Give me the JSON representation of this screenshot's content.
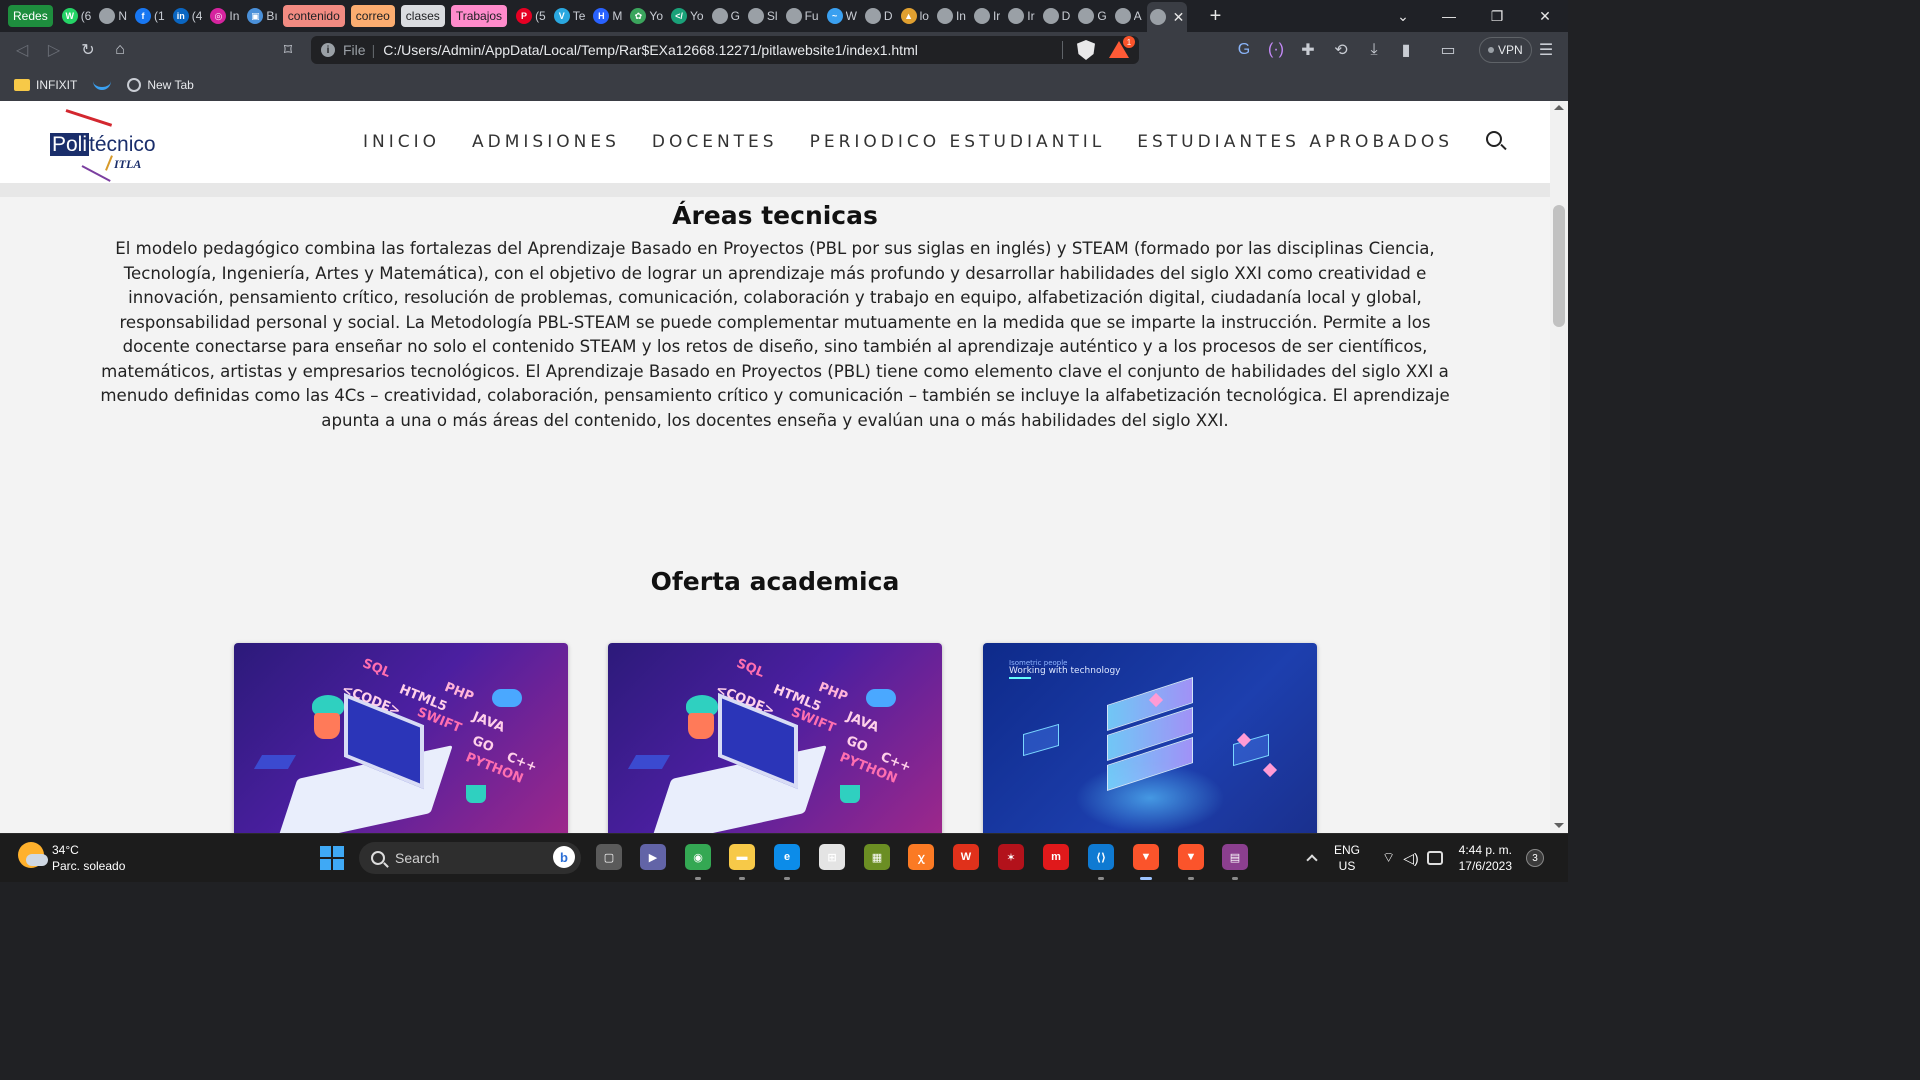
{
  "browser": {
    "tab_groups": [
      {
        "label": "Redes",
        "color": "#1e8e3e",
        "text_color": "#ffffff"
      },
      {
        "label": "contenido",
        "color": "#f28b82",
        "text_color": "#202124"
      },
      {
        "label": "correo",
        "color": "#fcad70",
        "text_color": "#202124"
      },
      {
        "label": "clases",
        "color": "#dadce0",
        "text_color": "#202124"
      },
      {
        "label": "Trabajos",
        "color": "#ff8bcb",
        "text_color": "#202124"
      }
    ],
    "tabs_redes": [
      {
        "icon": "whatsapp-icon",
        "glyph": "W",
        "color": "#25d366",
        "label": "(6"
      },
      {
        "icon": "globe-icon",
        "glyph": "",
        "color": "#9aa0a6",
        "label": "N"
      },
      {
        "icon": "facebook-icon",
        "glyph": "f",
        "color": "#1877f2",
        "label": "(1"
      },
      {
        "icon": "linkedin-icon",
        "glyph": "in",
        "color": "#0a66c2",
        "label": "(4"
      },
      {
        "icon": "instagram-icon",
        "glyph": "◎",
        "color": "#d6249f",
        "label": "In"
      },
      {
        "icon": "image-icon",
        "glyph": "▣",
        "color": "#4a90d9",
        "label": "Bı"
      }
    ],
    "tabs_trabajos": [
      {
        "icon": "pinterest-icon",
        "glyph": "P",
        "color": "#e60023",
        "label": "(5"
      },
      {
        "icon": "tw-icon",
        "glyph": "V",
        "color": "#2aa8e0",
        "label": "Te"
      },
      {
        "icon": "hashnode-icon",
        "glyph": "H",
        "color": "#2962ff",
        "label": "M"
      },
      {
        "icon": "leaf-icon",
        "glyph": "✿",
        "color": "#3ba55d",
        "label": "Yo"
      },
      {
        "icon": "code-icon",
        "glyph": "</",
        "color": "#1aa179",
        "label": "Yo"
      },
      {
        "icon": "globe-icon",
        "glyph": "",
        "color": "#9aa0a6",
        "label": "G"
      },
      {
        "icon": "globe-icon",
        "glyph": "",
        "color": "#9aa0a6",
        "label": "Sl"
      },
      {
        "icon": "globe-icon",
        "glyph": "",
        "color": "#9aa0a6",
        "label": "Fu"
      },
      {
        "icon": "wave-icon",
        "glyph": "~",
        "color": "#3aa0f0",
        "label": "W"
      },
      {
        "icon": "globe-icon",
        "glyph": "",
        "color": "#9aa0a6",
        "label": "D"
      },
      {
        "icon": "itla-icon",
        "glyph": "▲",
        "color": "#e0a030",
        "label": "lo"
      },
      {
        "icon": "globe-icon",
        "glyph": "",
        "color": "#9aa0a6",
        "label": "In"
      },
      {
        "icon": "globe-icon",
        "glyph": "",
        "color": "#9aa0a6",
        "label": "Ir"
      },
      {
        "icon": "globe-icon",
        "glyph": "",
        "color": "#9aa0a6",
        "label": "Ir"
      },
      {
        "icon": "globe-icon",
        "glyph": "",
        "color": "#9aa0a6",
        "label": "D"
      },
      {
        "icon": "globe-icon",
        "glyph": "",
        "color": "#9aa0a6",
        "label": "G"
      },
      {
        "icon": "globe-icon",
        "glyph": "",
        "color": "#9aa0a6",
        "label": "A"
      }
    ],
    "active_tab": {
      "label": "",
      "close": "✕"
    },
    "new_tab": "+",
    "window": {
      "dropdown": "⌄",
      "minimize": "—",
      "restore": "❐",
      "close": "✕"
    },
    "address": {
      "scheme_label": "File",
      "separator": "|",
      "url": "C:/Users/Admin/AppData/Local/Temp/Rar$EXa12668.12271/pitlawebsite1/index1.html",
      "rewards_badge": "1"
    },
    "vpn_label": "VPN",
    "bookmarks": [
      {
        "icon": "folder-icon",
        "label": "INFIXIT"
      },
      {
        "icon": "wave-icon",
        "label": ""
      },
      {
        "icon": "globe-icon",
        "label": "New Tab"
      }
    ]
  },
  "site": {
    "logo": {
      "prefix": "Poli",
      "suffix": "técnico",
      "subtitle": "ITLA"
    },
    "nav": [
      "INICIO",
      "ADMISIONES",
      "DOCENTES",
      "PERIODICO ESTUDIANTIL",
      "ESTUDIANTES APROBADOS"
    ],
    "areas": {
      "title": "Áreas tecnicas",
      "body": "El modelo pedagógico combina las fortalezas del Aprendizaje Basado en Proyectos (PBL por sus siglas en inglés) y STEAM (formado por las disciplinas Ciencia, Tecnología, Ingeniería, Artes y Matemática), con el objetivo de lograr un aprendizaje más profundo y desarrollar habilidades del siglo XXI como creatividad e innovación, pensamiento crítico, resolución de problemas, comunicación, colaboración y trabajo en equipo, alfabetización digital, ciudadanía local y global, responsabilidad personal y social. La Metodología PBL-STEAM se puede complementar mutuamente en la medida que se imparte la instrucción. Permite a los docente conectarse para enseñar no solo el contenido STEAM y los retos de diseño, sino también al aprendizaje auténtico y a los procesos de ser científicos, matemáticos, artistas y empresarios tecnológicos. El Aprendizaje Basado en Proyectos (PBL) tiene como elemento clave el conjunto de habilidades del siglo XXI a menudo definidas como las 4Cs – creatividad, colaboración, pensamiento crítico y comunicación – también se incluye la alfabetización tecnológica. El aprendizaje apunta a una o más áreas del contenido, los docentes enseña y evalúan una o más habilidades del siglo XXI."
    },
    "oferta": {
      "title": "Oferta academica",
      "cards": [
        {
          "kind": "code",
          "keywords": [
            "SQL",
            "PHP",
            "<CODE>",
            "HTML5",
            "SWIFT",
            "JAVA",
            "GO",
            "PYTHON",
            "C++"
          ]
        },
        {
          "kind": "code",
          "keywords": [
            "SQL",
            "PHP",
            "<CODE>",
            "HTML5",
            "SWIFT",
            "JAVA",
            "GO",
            "PYTHON",
            "C++"
          ]
        },
        {
          "kind": "tech",
          "caption_small": "Isometric people",
          "caption": "Working with technology"
        }
      ]
    }
  },
  "taskbar": {
    "weather": {
      "temp": "34°C",
      "desc": "Parc. soleado"
    },
    "search_label": "Search",
    "search_badge": "b",
    "apps": [
      {
        "name": "task-view-icon",
        "glyph": "▢",
        "color": "#5a5a5a"
      },
      {
        "name": "teams-icon",
        "glyph": "▶",
        "color": "#6264a7"
      },
      {
        "name": "chrome-icon",
        "glyph": "◉",
        "color": "#34a853"
      },
      {
        "name": "file-explorer-icon",
        "glyph": "▬",
        "color": "#f7c948"
      },
      {
        "name": "edge-icon",
        "glyph": "e",
        "color": "#0c8ce9"
      },
      {
        "name": "store-icon",
        "glyph": "⊞",
        "color": "#e4e4e4"
      },
      {
        "name": "minecraft-icon",
        "glyph": "▦",
        "color": "#6b8e23"
      },
      {
        "name": "xampp-icon",
        "glyph": "ꭓ",
        "color": "#fb7a24"
      },
      {
        "name": "wps-office-icon",
        "glyph": "W",
        "color": "#e0311b"
      },
      {
        "name": "spiderman-icon",
        "glyph": "✶",
        "color": "#b3121b"
      },
      {
        "name": "mcafee-icon",
        "glyph": "m",
        "color": "#e0191b"
      },
      {
        "name": "vscode-icon",
        "glyph": "⟨⟩",
        "color": "#0f7ad2"
      },
      {
        "name": "brave-icon",
        "glyph": "▼",
        "color": "#fb542b"
      },
      {
        "name": "brave-beta-icon",
        "glyph": "▼",
        "color": "#fb542b"
      },
      {
        "name": "winrar-icon",
        "glyph": "▤",
        "color": "#8b3f8f"
      }
    ],
    "lang": {
      "line1": "ENG",
      "line2": "US"
    },
    "clock": {
      "time": "4:44 p. m.",
      "date": "17/6/2023"
    },
    "notifications": "3"
  }
}
